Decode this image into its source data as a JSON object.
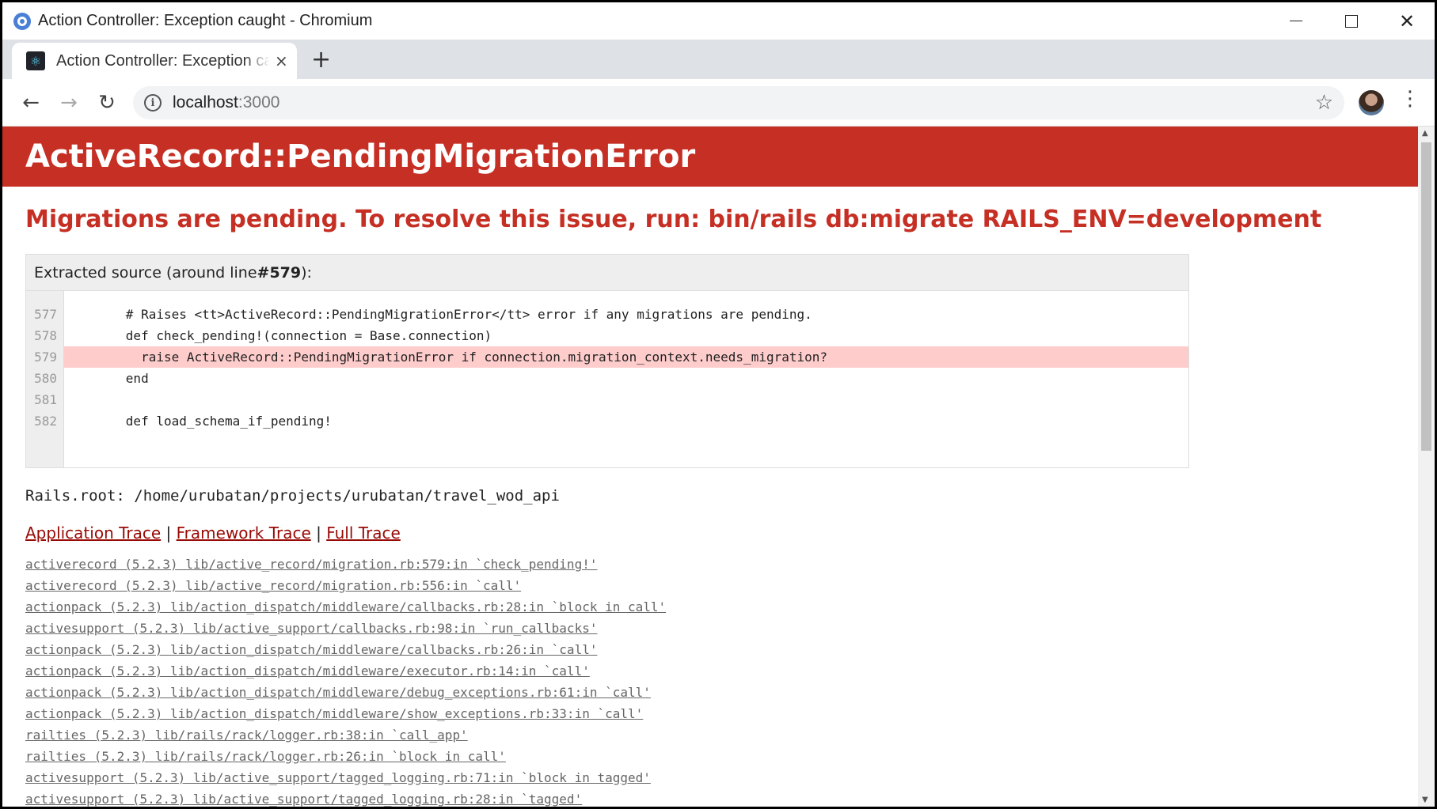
{
  "window": {
    "title": "Action Controller: Exception caught - Chromium"
  },
  "tab": {
    "label": "Action Controller: Exception caught",
    "close": "×"
  },
  "new_tab": "+",
  "toolbar": {
    "host": "localhost",
    "port": ":3000"
  },
  "error": {
    "name": "ActiveRecord::PendingMigrationError",
    "message": "Migrations are pending. To resolve this issue, run: bin/rails db:migrate RAILS_ENV=development"
  },
  "source": {
    "heading_prefix": "Extracted source (around line ",
    "heading_line": "#579",
    "heading_suffix": "):",
    "lines": [
      {
        "num": "577",
        "code": "      # Raises <tt>ActiveRecord::PendingMigrationError</tt> error if any migrations are pending."
      },
      {
        "num": "578",
        "code": "      def check_pending!(connection = Base.connection)"
      },
      {
        "num": "579",
        "code": "        raise ActiveRecord::PendingMigrationError if connection.migration_context.needs_migration?"
      },
      {
        "num": "580",
        "code": "      end"
      },
      {
        "num": "581",
        "code": ""
      },
      {
        "num": "582",
        "code": "      def load_schema_if_pending!"
      }
    ]
  },
  "rails_root": "Rails.root: /home/urubatan/projects/urubatan/travel_wod_api",
  "trace_links": {
    "application": "Application Trace",
    "framework": "Framework Trace",
    "full": "Full Trace",
    "separator": " | "
  },
  "trace": [
    "activerecord (5.2.3) lib/active_record/migration.rb:579:in `check_pending!'",
    "activerecord (5.2.3) lib/active_record/migration.rb:556:in `call'",
    "actionpack (5.2.3) lib/action_dispatch/middleware/callbacks.rb:28:in `block in call'",
    "activesupport (5.2.3) lib/active_support/callbacks.rb:98:in `run_callbacks'",
    "actionpack (5.2.3) lib/action_dispatch/middleware/callbacks.rb:26:in `call'",
    "actionpack (5.2.3) lib/action_dispatch/middleware/executor.rb:14:in `call'",
    "actionpack (5.2.3) lib/action_dispatch/middleware/debug_exceptions.rb:61:in `call'",
    "actionpack (5.2.3) lib/action_dispatch/middleware/show_exceptions.rb:33:in `call'",
    "railties (5.2.3) lib/rails/rack/logger.rb:38:in `call_app'",
    "railties (5.2.3) lib/rails/rack/logger.rb:26:in `block in call'",
    "activesupport (5.2.3) lib/active_support/tagged_logging.rb:71:in `block in tagged'",
    "activesupport (5.2.3) lib/active_support/tagged_logging.rb:28:in `tagged'"
  ],
  "colors": {
    "header_bg": "#c52f24",
    "link": "#980905",
    "highlight": "#ffcccc"
  },
  "icons": [
    "chromium-icon",
    "react-favicon-icon",
    "back-arrow-icon",
    "forward-arrow-icon",
    "reload-icon",
    "info-icon",
    "star-icon",
    "profile-avatar",
    "kebab-menu-icon"
  ]
}
